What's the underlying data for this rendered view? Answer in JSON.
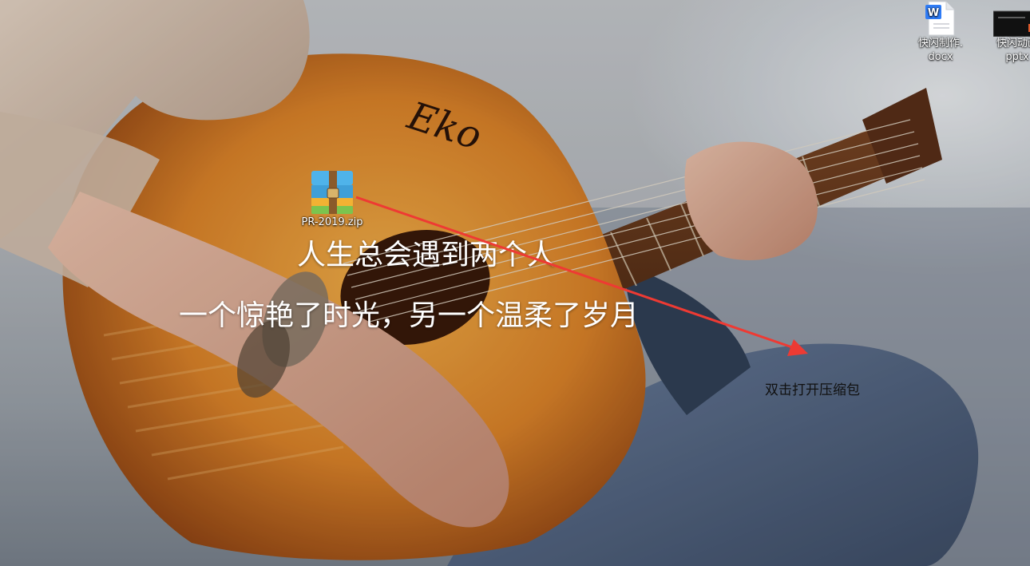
{
  "desktop": {
    "icons": [
      {
        "name": "docx-file",
        "label_line1": "快闪制作.",
        "label_line2": "docx",
        "icon": "wps-word-document-icon"
      },
      {
        "name": "pptx-file",
        "label_line1": "快闪动画",
        "label_line2": "pptx",
        "icon": "pptx-thumbnail-icon"
      },
      {
        "name": "zip-file",
        "label": "PR-2019.zip",
        "icon": "winrar-archive-icon"
      }
    ]
  },
  "overlay": {
    "line1": "人生总会遇到两个人",
    "line2": "一个惊艳了时光，另一个温柔了岁月"
  },
  "annotation": {
    "text": "双击打开压缩包",
    "arrow_color": "#ee3a33"
  },
  "colors": {
    "guitar_body": "#e08a2a",
    "jeans": "#5f7492",
    "sky": "#c9ccd0"
  }
}
